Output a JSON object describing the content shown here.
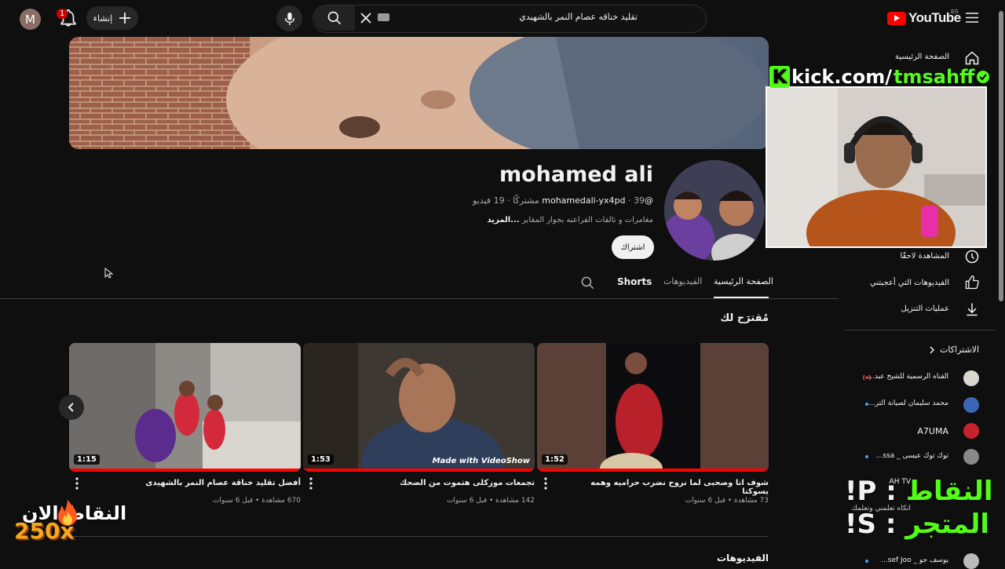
{
  "topbar": {
    "avatar_letter": "M",
    "notification_count": "1",
    "create_label": "إنشاء",
    "search_query": "تقليد خناقه عصام النمر بالشهيدي",
    "logo_text": "YouTube",
    "region": "EG"
  },
  "channel": {
    "name": "mohamed ali",
    "handle": "@mohamedali-yx4pd",
    "stats": " ‧ 39 مشتركًا ‧ 19 فيديو",
    "description": "مغامرات و تالفات الفراعنه بجوار المقابر",
    "more": " ...المزيد",
    "subscribe_label": "اشتراك"
  },
  "tabs": [
    {
      "label": "الصفحة الرئيسية",
      "active": true
    },
    {
      "label": "الفيديوهات",
      "active": false
    },
    {
      "label": "Shorts",
      "active": false
    }
  ],
  "sections": {
    "for_you": "مُقترَح لك",
    "videos": "الفيديوهات"
  },
  "videos": [
    {
      "title": "شوف انا وصحبى لما نروح نضرب حراميه وهمه يسوكنا",
      "meta": "73 مشاهدة • قبل 6 سنوات",
      "duration": "1:52",
      "progress": 1.0
    },
    {
      "title": "تجمعات موزكلى هتموت من الضحك",
      "meta": "142 مشاهدة • قبل 6 سنوات",
      "duration": "1:53",
      "progress": 1.0
    },
    {
      "title": "أفضل تقليد خناقة عصام النمر بالشهيدى",
      "meta": "670 مشاهدة • قبل 6 سنوات",
      "duration": "1:15",
      "progress": 1.0
    }
  ],
  "watermark": "Made with VideoShow",
  "sidebar": {
    "items": [
      {
        "label": "الصفحة الرئيسية",
        "icon": "home-icon"
      },
      {
        "label": "المشاهدة لاحقًا",
        "icon": "clock-icon"
      },
      {
        "label": "الفيديوهات التي أعجبتني",
        "icon": "thumbs-up-icon"
      },
      {
        "label": "عمليات التنزيل",
        "icon": "download-icon"
      }
    ],
    "subscriptions_title": "الاشتراكات",
    "subscriptions": [
      {
        "name": "القناه الرسمية للشيخ عبد...",
        "live": true
      },
      {
        "name": "محمد سليمان لصيانة التر...",
        "live": false
      },
      {
        "name": "A7UMA",
        "live": false
      },
      {
        "name": "توك توك عيسى _ ssa...",
        "live": false
      },
      {
        "name": "AH TV",
        "live": false
      },
      {
        "name": "اتكاه تعلمني وتعلمك",
        "live": false
      },
      {
        "name": "يوسف جو _ sef Joo...",
        "live": false
      }
    ]
  },
  "overlay": {
    "kick_prefix": "kick.com/",
    "kick_user": "tmsahff",
    "points_label": "النقاط الان",
    "points_value": "250x",
    "points_cmd_ar": "النقاط",
    "points_cmd": "!P :",
    "store_cmd_ar": "المتجر",
    "store_cmd": "!S :"
  },
  "colors": {
    "background": "#0f0f0f",
    "accent_red": "#ff0000",
    "kick_green": "#53fc18"
  }
}
